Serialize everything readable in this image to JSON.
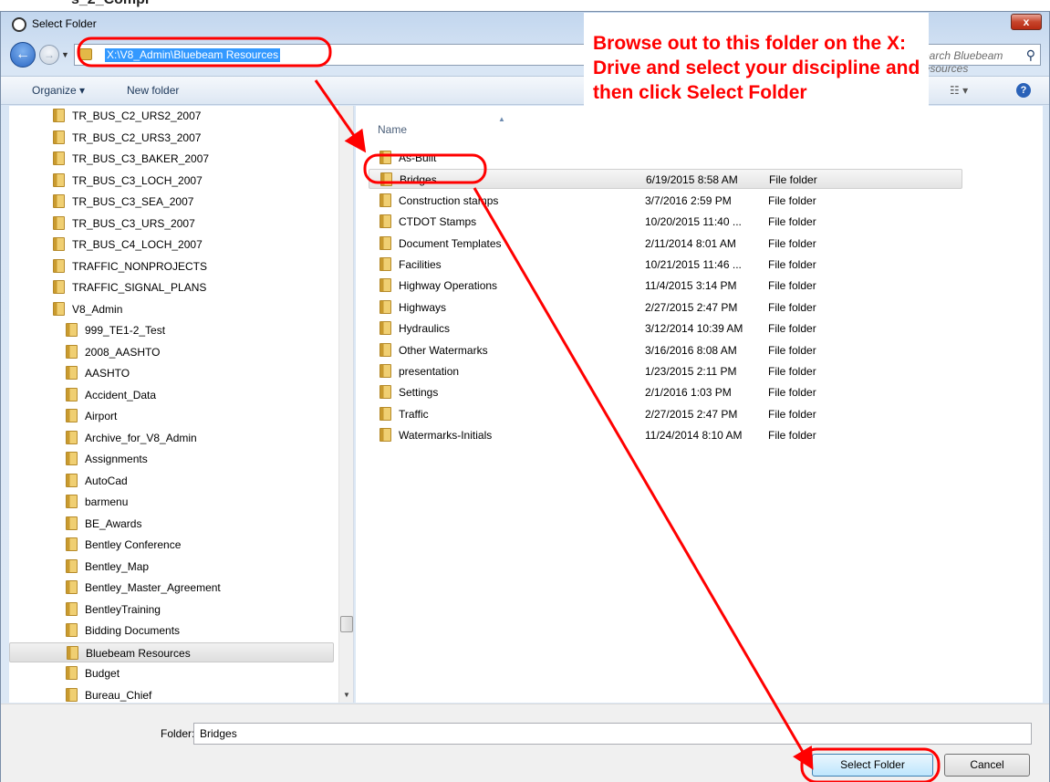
{
  "window": {
    "title": "Select Folder",
    "close_label": "x"
  },
  "nav": {
    "address": "X:\\V8_Admin\\Bluebeam Resources",
    "search_placeholder": "Search Bluebeam Resources"
  },
  "toolbar": {
    "organize": "Organize ▾",
    "new_folder": "New folder",
    "view": "☷ ▾",
    "help": "?"
  },
  "tree": {
    "items": [
      {
        "label": "TR_BUS_C2_URS2_2007",
        "indent": 0
      },
      {
        "label": "TR_BUS_C2_URS3_2007",
        "indent": 0
      },
      {
        "label": "TR_BUS_C3_BAKER_2007",
        "indent": 0
      },
      {
        "label": "TR_BUS_C3_LOCH_2007",
        "indent": 0
      },
      {
        "label": "TR_BUS_C3_SEA_2007",
        "indent": 0
      },
      {
        "label": "TR_BUS_C3_URS_2007",
        "indent": 0
      },
      {
        "label": "TR_BUS_C4_LOCH_2007",
        "indent": 0
      },
      {
        "label": "TRAFFIC_NONPROJECTS",
        "indent": 0
      },
      {
        "label": "TRAFFIC_SIGNAL_PLANS",
        "indent": 0
      },
      {
        "label": "V8_Admin",
        "indent": 0
      },
      {
        "label": "999_TE1-2_Test",
        "indent": 1
      },
      {
        "label": "2008_AASHTO",
        "indent": 1
      },
      {
        "label": "AASHTO",
        "indent": 1
      },
      {
        "label": "Accident_Data",
        "indent": 1
      },
      {
        "label": "Airport",
        "indent": 1
      },
      {
        "label": "Archive_for_V8_Admin",
        "indent": 1
      },
      {
        "label": "Assignments",
        "indent": 1
      },
      {
        "label": "AutoCad",
        "indent": 1
      },
      {
        "label": "barmenu",
        "indent": 1
      },
      {
        "label": "BE_Awards",
        "indent": 1
      },
      {
        "label": "Bentley Conference",
        "indent": 1
      },
      {
        "label": "Bentley_Map",
        "indent": 1
      },
      {
        "label": "Bentley_Master_Agreement",
        "indent": 1
      },
      {
        "label": "BentleyTraining",
        "indent": 1
      },
      {
        "label": "Bidding Documents",
        "indent": 1
      },
      {
        "label": "Bluebeam Resources",
        "indent": 1,
        "selected": true
      },
      {
        "label": "Budget",
        "indent": 1
      },
      {
        "label": "Bureau_Chief",
        "indent": 1
      }
    ]
  },
  "list": {
    "column_name": "Name",
    "rows": [
      {
        "name": "As-Built",
        "date": "",
        "type": ""
      },
      {
        "name": "Bridges",
        "date": "6/19/2015 8:58 AM",
        "type": "File folder",
        "selected": true
      },
      {
        "name": "Construction stamps",
        "date": "3/7/2016 2:59 PM",
        "type": "File folder"
      },
      {
        "name": "CTDOT Stamps",
        "date": "10/20/2015 11:40 ...",
        "type": "File folder"
      },
      {
        "name": "Document Templates",
        "date": "2/11/2014 8:01 AM",
        "type": "File folder"
      },
      {
        "name": "Facilities",
        "date": "10/21/2015 11:46 ...",
        "type": "File folder"
      },
      {
        "name": "Highway Operations",
        "date": "11/4/2015 3:14 PM",
        "type": "File folder"
      },
      {
        "name": "Highways",
        "date": "2/27/2015 2:47 PM",
        "type": "File folder"
      },
      {
        "name": "Hydraulics",
        "date": "3/12/2014 10:39 AM",
        "type": "File folder"
      },
      {
        "name": "Other Watermarks",
        "date": "3/16/2016 8:08 AM",
        "type": "File folder"
      },
      {
        "name": "presentation",
        "date": "1/23/2015 2:11 PM",
        "type": "File folder"
      },
      {
        "name": "Settings",
        "date": "2/1/2016 1:03 PM",
        "type": "File folder"
      },
      {
        "name": "Traffic",
        "date": "2/27/2015 2:47 PM",
        "type": "File folder"
      },
      {
        "name": "Watermarks-Initials",
        "date": "11/24/2014 8:10 AM",
        "type": "File folder"
      }
    ]
  },
  "footer": {
    "folder_label": "Folder:",
    "folder_value": "Bridges",
    "select_button": "Select Folder",
    "cancel_button": "Cancel"
  },
  "annotation": {
    "text": "Browse out to this folder on the X: Drive and select your discipline and then click Select Folder",
    "color": "#ff0000"
  },
  "background_fragment": "s_2_Compl"
}
